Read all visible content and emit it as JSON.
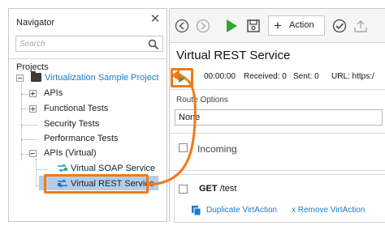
{
  "navigator": {
    "title": "Navigator",
    "close_glyph": "✕",
    "search_placeholder": "Search",
    "projects_label": "Projects",
    "tree": {
      "project": "Virtualization Sample Project",
      "apis": "APIs",
      "functional_tests": "Functional Tests",
      "security_tests": "Security Tests",
      "performance_tests": "Performance Tests",
      "apis_virtual": "APIs (Virtual)",
      "virtual_soap": "Virtual SOAP Service",
      "virtual_rest": "Virtual REST Service"
    }
  },
  "toolbar": {
    "action_label": "Action",
    "action_plus": "+",
    "icons": [
      "back-icon",
      "forward-icon",
      "run-icon",
      "save-icon",
      "add-icon",
      "check-icon",
      "export-icon"
    ]
  },
  "editor": {
    "title": "Virtual REST Service",
    "runbar": {
      "time": "00:00:00",
      "received": "Received: 0",
      "sent": "Sent: 0",
      "url": "URL: https:/"
    },
    "route_options_label": "Route Options",
    "route_value": "None",
    "incoming_label": "Incoming",
    "virt_action": {
      "method": "GET",
      "path": "/test",
      "duplicate_label": "Duplicate VirtAction",
      "remove_label": "x Remove VirtAction"
    }
  },
  "colors": {
    "accent_orange": "#f07a17",
    "run_green": "#2aa832",
    "link_blue": "#1a7cc9",
    "selection_blue": "#b4cde8"
  }
}
